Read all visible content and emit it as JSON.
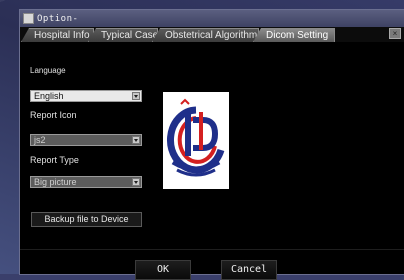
{
  "window": {
    "title": "Option-"
  },
  "tabs": [
    {
      "label": "Hospital Info",
      "active": false
    },
    {
      "label": "Typical Case",
      "active": false
    },
    {
      "label": "Obstetrical Algorithm",
      "active": false
    },
    {
      "label": "Dicom Setting",
      "active": true
    }
  ],
  "close_glyph": "×",
  "language": {
    "label": "Language",
    "value": "English"
  },
  "report_icon": {
    "label": "Report Icon",
    "value": "js2"
  },
  "report_type": {
    "label": "Report Type",
    "value": "Big picture"
  },
  "backup_label": "Backup file to Device",
  "ok_label": "OK",
  "cancel_label": "Cancel",
  "logo": {
    "icon": "hospital-logo",
    "colors": {
      "red": "#d42020",
      "blue": "#1f2f8a"
    }
  }
}
